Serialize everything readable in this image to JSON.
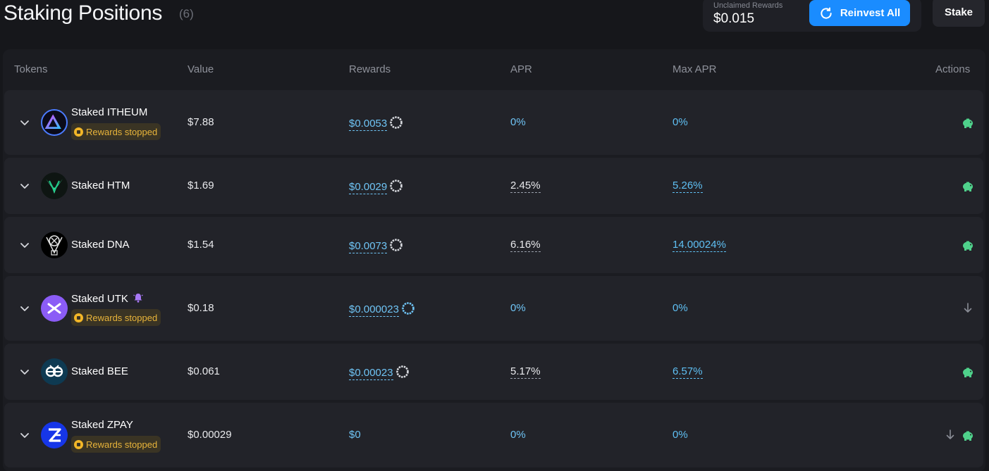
{
  "header": {
    "title": "Staking Positions",
    "count": "(6)",
    "unclaimed_label": "Unclaimed Rewards",
    "unclaimed_value": "$0.015",
    "reinvest_label": "Reinvest All",
    "stake_label": "Stake"
  },
  "table": {
    "columns": [
      "Tokens",
      "Value",
      "Rewards",
      "APR",
      "Max APR",
      "Actions"
    ],
    "rows": [
      {
        "name": "Staked ITHEUM",
        "badge": "Rewards stopped",
        "value": "$7.88",
        "rewards": "$0.0053",
        "apr": "0%",
        "max_apr": "0%"
      },
      {
        "name": "Staked HTM",
        "badge": "",
        "value": "$1.69",
        "rewards": "$0.0029",
        "apr": "2.45%",
        "max_apr": "5.26%"
      },
      {
        "name": "Staked DNA",
        "badge": "",
        "value": "$1.54",
        "rewards": "$0.0073",
        "apr": "6.16%",
        "max_apr": "14.00024%"
      },
      {
        "name": "Staked UTK",
        "badge": "Rewards stopped",
        "value": "$0.18",
        "rewards": "$0.000023",
        "apr": "0%",
        "max_apr": "0%"
      },
      {
        "name": "Staked BEE",
        "badge": "",
        "value": "$0.061",
        "rewards": "$0.00023",
        "apr": "5.17%",
        "max_apr": "6.57%"
      },
      {
        "name": "Staked ZPAY",
        "badge": "Rewards stopped",
        "value": "$0.00029",
        "rewards": "$0",
        "apr": "0%",
        "max_apr": "0%"
      }
    ]
  },
  "icons": {
    "reinvest": "refresh-icon",
    "expand": "chevron-down-icon",
    "rewards_status": "progress-ring-icon",
    "claim": "piggy-bank-icon",
    "unstake": "arrow-down-icon",
    "notification": "bell-icon",
    "badge": "coin-icon"
  },
  "colors": {
    "accent": "#1a8cff",
    "link": "#6fc4f5",
    "badge_text": "#e8b43a",
    "action_green": "#4fd18b"
  }
}
